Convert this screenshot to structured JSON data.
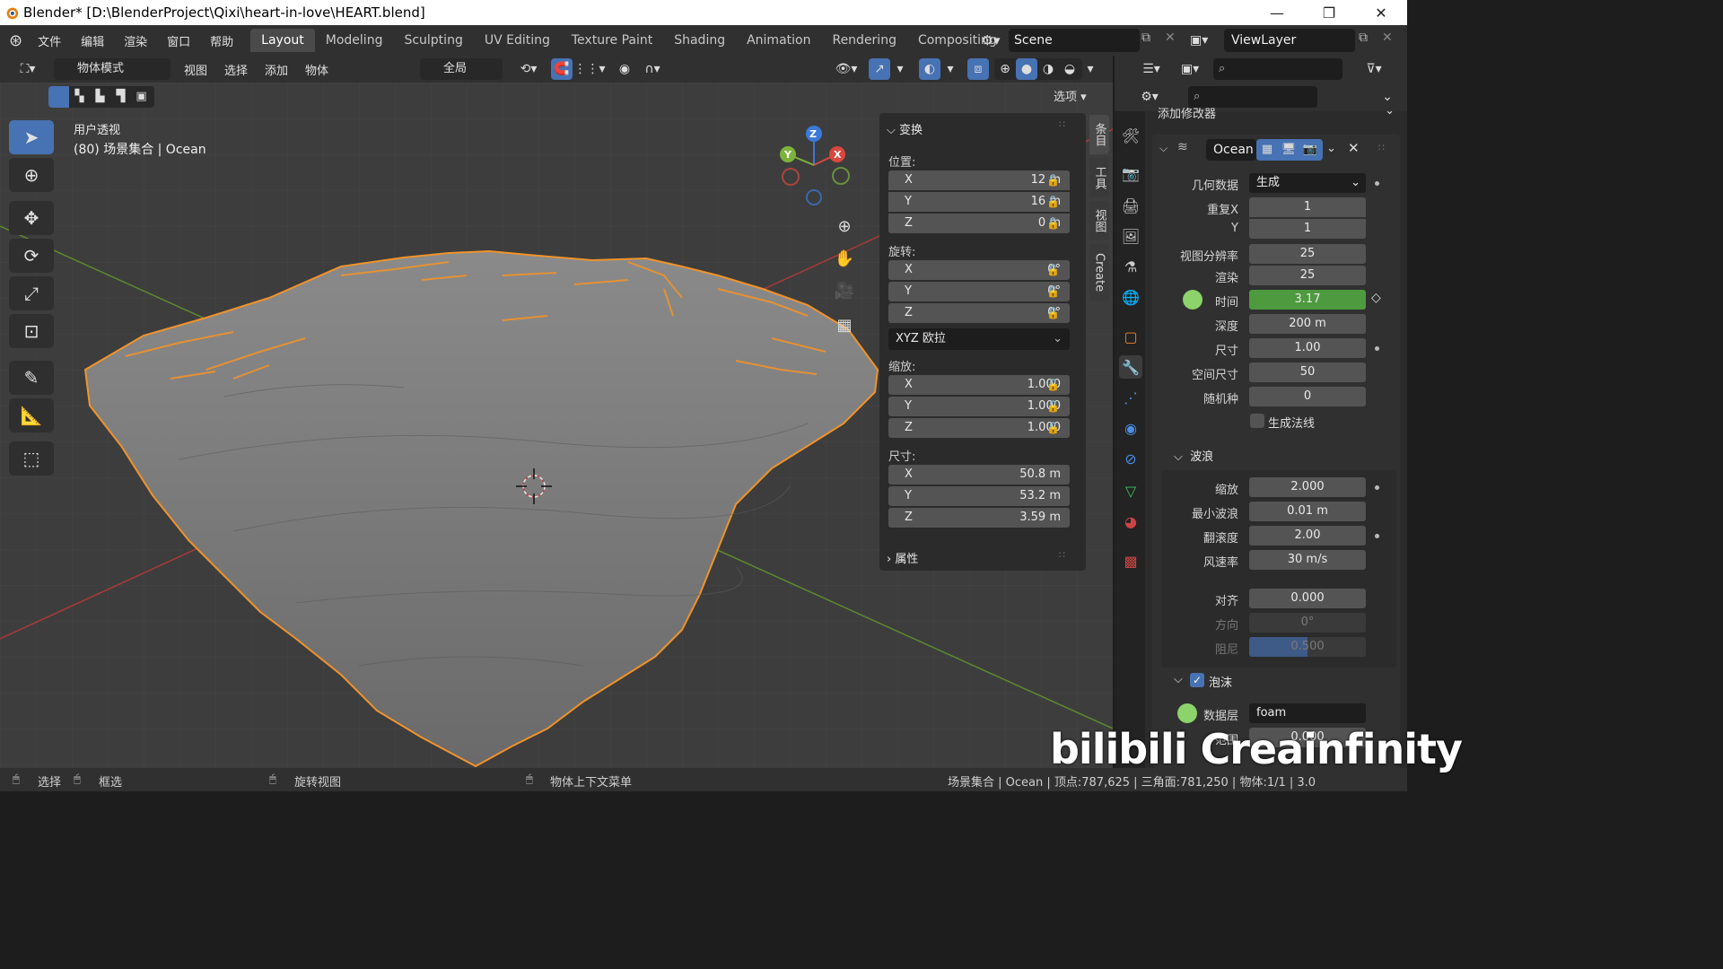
{
  "window": {
    "title": "Blender* [D:\\BlenderProject\\Qixi\\heart-in-love\\HEART.blend]",
    "minimize": "—",
    "maximize": "❐",
    "close": "✕"
  },
  "menu": {
    "items": [
      "文件",
      "编辑",
      "渲染",
      "窗口",
      "帮助"
    ],
    "workspaces": [
      "Layout",
      "Modeling",
      "Sculpting",
      "UV Editing",
      "Texture Paint",
      "Shading",
      "Animation",
      "Rendering",
      "Compositing"
    ],
    "active_workspace": "Layout",
    "scene": "Scene",
    "view_layer": "ViewLayer"
  },
  "viewport_header": {
    "mode": "物体模式",
    "menus": [
      "视图",
      "选择",
      "添加",
      "物体"
    ],
    "transform_orientation": "全局",
    "options": "选项"
  },
  "viewport": {
    "view_name": "用户透视",
    "collection_info": "(80) 场景集合 | Ocean",
    "gizmo": {
      "x": "X",
      "y": "Y",
      "z": "Z"
    }
  },
  "npanel": {
    "section_transform": "变换",
    "location_label": "位置:",
    "location": [
      {
        "axis": "X",
        "value": "12 m"
      },
      {
        "axis": "Y",
        "value": "16 m"
      },
      {
        "axis": "Z",
        "value": "0 m"
      }
    ],
    "rotation_label": "旋转:",
    "rotation": [
      {
        "axis": "X",
        "value": "0°"
      },
      {
        "axis": "Y",
        "value": "0°"
      },
      {
        "axis": "Z",
        "value": "0°"
      }
    ],
    "rotation_mode": "XYZ 欧拉",
    "scale_label": "缩放:",
    "scale": [
      {
        "axis": "X",
        "value": "1.000"
      },
      {
        "axis": "Y",
        "value": "1.000"
      },
      {
        "axis": "Z",
        "value": "1.000"
      }
    ],
    "dimensions_label": "尺寸:",
    "dimensions": [
      {
        "axis": "X",
        "value": "50.8 m"
      },
      {
        "axis": "Y",
        "value": "53.2 m"
      },
      {
        "axis": "Z",
        "value": "3.59 m"
      }
    ],
    "section_properties": "属性",
    "tabs": [
      "条目",
      "工具",
      "视图",
      "Create"
    ]
  },
  "properties": {
    "add_modifier": "添加修改器",
    "modifier_name": "Ocean",
    "rows": [
      {
        "label": "几何数据",
        "value": "生成",
        "kind": "dropdown"
      },
      {
        "label": "重复X",
        "value": "1"
      },
      {
        "label": "Y",
        "value": "1"
      },
      {
        "label": "视图分辨率",
        "value": "25"
      },
      {
        "label": "渲染",
        "value": "25"
      },
      {
        "label": "时间",
        "value": "3.17",
        "kind": "green"
      },
      {
        "label": "深度",
        "value": "200 m"
      },
      {
        "label": "尺寸",
        "value": "1.00"
      },
      {
        "label": "空间尺寸",
        "value": "50"
      },
      {
        "label": "随机种",
        "value": "0"
      }
    ],
    "generate_normals": "生成法线",
    "waves_section": "波浪",
    "wave_rows": [
      {
        "label": "缩放",
        "value": "2.000"
      },
      {
        "label": "最小波浪",
        "value": "0.01 m"
      },
      {
        "label": "翻滚度",
        "value": "2.00"
      },
      {
        "label": "风速率",
        "value": "30 m/s"
      }
    ],
    "align_rows": [
      {
        "label": "对齐",
        "value": "0.000"
      },
      {
        "label": "方向",
        "value": "0°"
      },
      {
        "label": "阻尼",
        "value": "0.500"
      }
    ],
    "foam_section": "泡沫",
    "foam_rows": [
      {
        "label": "数据层",
        "value": "foam"
      },
      {
        "label": "范围",
        "value": "0.000"
      }
    ]
  },
  "statusbar": {
    "select": "选择",
    "box_select": "框选",
    "rotate_view": "旋转视图",
    "context_menu": "物体上下文菜单",
    "stats": "场景集合 | Ocean | 顶点:787,625 | 三角面:781,250 | 物体:1/1 | 3.0"
  },
  "watermark": "bilibili Creainfinity",
  "colors": {
    "accent": "#4772b3",
    "selection_outline": "#f0932b",
    "time_field": "#4e9a3f"
  }
}
